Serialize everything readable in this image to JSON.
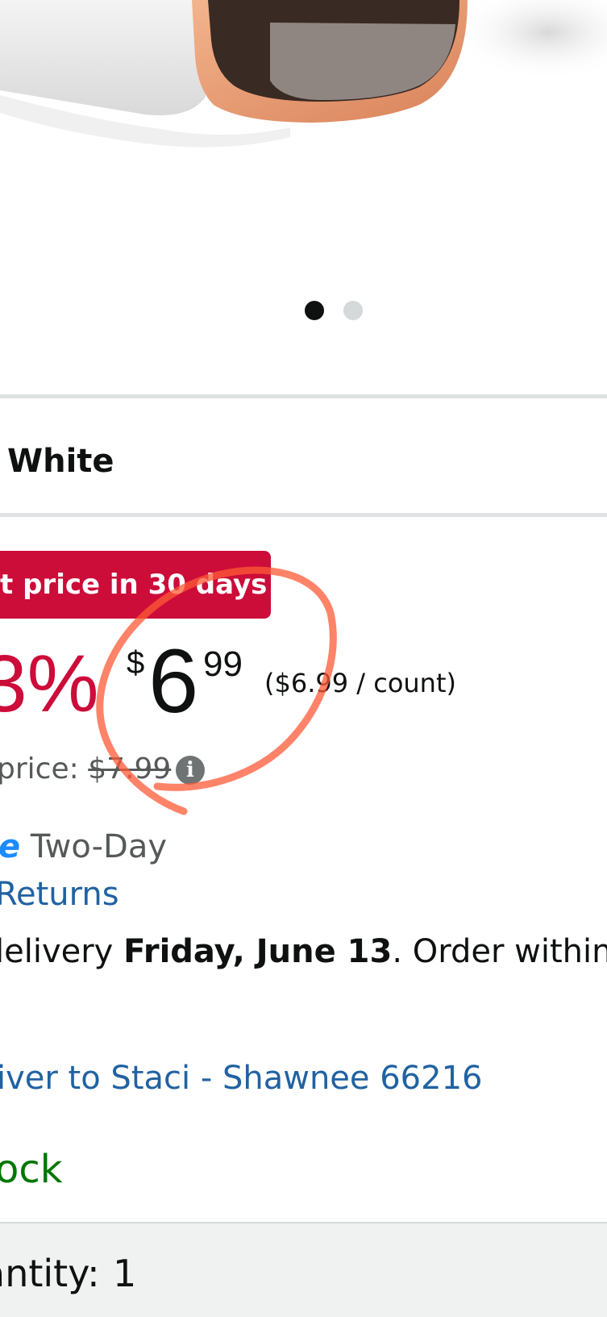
{
  "carousel": {
    "dot_count": 2,
    "active_index": 0
  },
  "variant": {
    "value": "White"
  },
  "deal_badge": {
    "text": "t price in 30 days"
  },
  "pricing": {
    "discount": "3%",
    "symbol": "$",
    "whole": "6",
    "fraction": "99",
    "unit_price": "($6.99 / count)",
    "list_price_label": "price:",
    "list_price_value": "$7.99"
  },
  "shipping": {
    "prime_fragment": "e",
    "two_day": "Two-Day",
    "returns": "Returns",
    "delivery_prefix": "lelivery",
    "delivery_date": "Friday, June 13",
    "delivery_suffix": ". Order within"
  },
  "location": {
    "deliver_to": "iver to Staci - Shawnee 66216"
  },
  "availability": {
    "status": "ock"
  },
  "quantity": {
    "label": "antity:",
    "value": "1"
  },
  "colors": {
    "deal_red": "#cc0c39",
    "link_blue": "#2162a1",
    "stock_green": "#007600",
    "annotation": "#ff5a36"
  }
}
